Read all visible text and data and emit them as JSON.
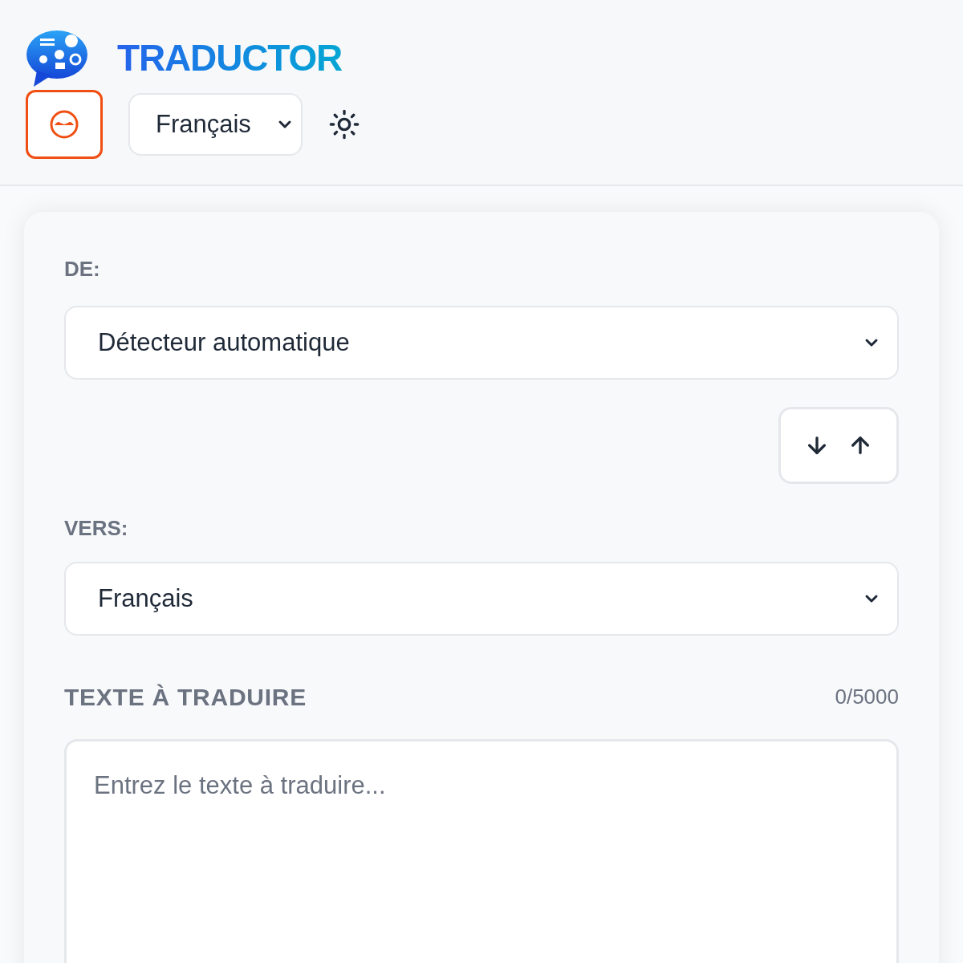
{
  "header": {
    "title": "TRADUCTOR",
    "language": "Français"
  },
  "from": {
    "label": "DE:",
    "value": "Détecteur automatique"
  },
  "to": {
    "label": "VERS:",
    "value": "Français"
  },
  "source": {
    "label": "TEXTE À TRADUIRE",
    "counter": "0/5000",
    "placeholder": "Entrez le texte à traduire..."
  }
}
